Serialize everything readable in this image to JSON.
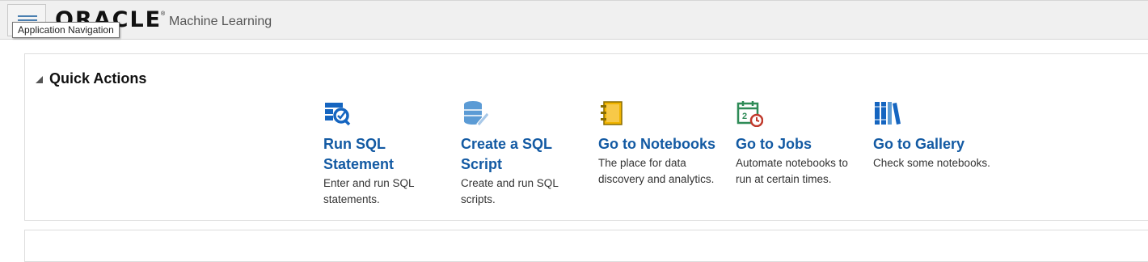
{
  "header": {
    "menu_tooltip": "Application Navigation",
    "logo_text": "ORACLE",
    "logo_mark": "®",
    "app_title": "Machine Learning"
  },
  "quick_actions": {
    "title": "Quick Actions",
    "items": [
      {
        "title": "Run SQL Statement",
        "description": "Enter and run SQL statements.",
        "icon": "sql-statement-icon"
      },
      {
        "title": "Create a SQL Script",
        "description": "Create and run SQL scripts.",
        "icon": "sql-script-icon"
      },
      {
        "title": "Go to Notebooks",
        "description": "The place for data discovery and analytics.",
        "icon": "notebooks-icon"
      },
      {
        "title": "Go to Jobs",
        "description": "Automate notebooks to run at certain times.",
        "icon": "jobs-icon"
      },
      {
        "title": "Go to Gallery",
        "description": "Check some notebooks.",
        "icon": "gallery-icon"
      }
    ]
  },
  "colors": {
    "link_blue": "#135aa3",
    "icon_blue": "#1565c0",
    "notebook_gold": "#f0b400",
    "jobs_green": "#2e8b57",
    "jobs_red": "#c0392b"
  }
}
